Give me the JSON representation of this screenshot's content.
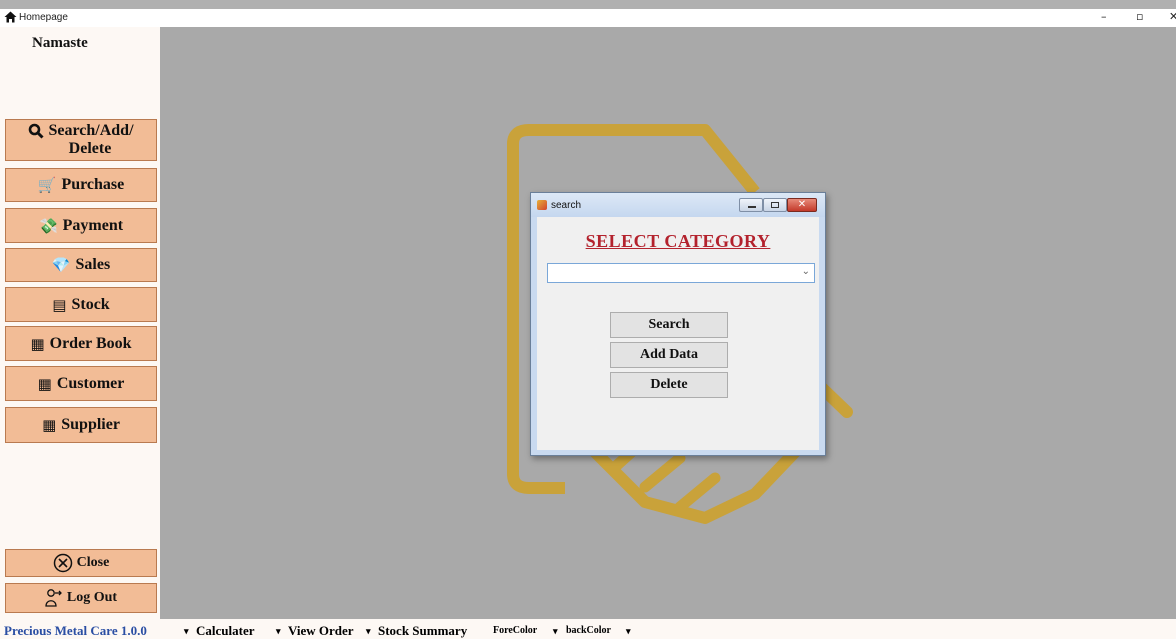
{
  "window": {
    "title": "Homepage",
    "minimize_glyph": "–",
    "maximize_glyph": "▫",
    "close_glyph": "✕"
  },
  "sidebar": {
    "greeting": "Namaste",
    "items": [
      {
        "line1": "Search/Add/",
        "line2": "Delete",
        "icon": "search-icon"
      },
      {
        "label": "Purchase",
        "icon": "cart-icon"
      },
      {
        "label": "Payment",
        "icon": "payment-icon"
      },
      {
        "label": "Sales",
        "icon": "sales-icon"
      },
      {
        "label": "Stock",
        "icon": "stock-icon"
      },
      {
        "label": "Order Book",
        "icon": "order-book-icon"
      },
      {
        "label": "Customer",
        "icon": "customer-icon"
      },
      {
        "label": "Supplier",
        "icon": "supplier-icon"
      }
    ],
    "close_label": "Close",
    "logout_label": "Log Out"
  },
  "menubar": {
    "items": [
      "Precious Metal Care 1.0.0",
      "Calculater",
      "View Order",
      "Stock Summary",
      "ForeColor",
      "backColor"
    ],
    "dropdown_glyph": "▾"
  },
  "search_dialog": {
    "title": "search",
    "heading": "SELECT CATEGORY",
    "category_value": "",
    "buttons": {
      "search": "Search",
      "add": "Add Data",
      "delete": "Delete"
    }
  },
  "colors": {
    "sidebar_button": "#f2bc96",
    "workspace": "#a9a9a9",
    "watermark": "#c9a23a",
    "heading": "#b3222d",
    "menubar_brand": "#2a4ea3"
  }
}
